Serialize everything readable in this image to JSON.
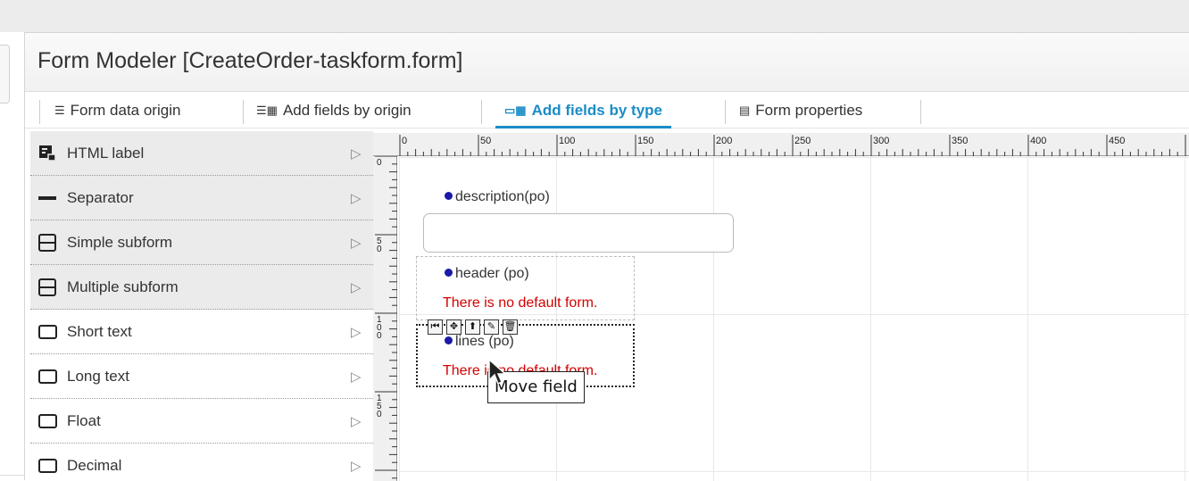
{
  "window": {
    "title": "Form Modeler [CreateOrder-taskform.form]"
  },
  "tabs": [
    {
      "label": "Form data origin",
      "icon": "database-icon",
      "active": false
    },
    {
      "label": "Add fields by origin",
      "icon": "add-fields-origin-icon",
      "active": false
    },
    {
      "label": "Add fields by type",
      "icon": "add-fields-type-icon",
      "active": true
    },
    {
      "label": "Form properties",
      "icon": "form-properties-icon",
      "active": false
    }
  ],
  "palette": {
    "items": [
      {
        "label": "HTML label",
        "icon": "html-label-icon"
      },
      {
        "label": "Separator",
        "icon": "separator-icon"
      },
      {
        "label": "Simple subform",
        "icon": "subform-icon"
      },
      {
        "label": "Multiple subform",
        "icon": "subform-icon"
      },
      {
        "label": "Short text",
        "icon": "textbox-icon"
      },
      {
        "label": "Long text",
        "icon": "textbox-icon"
      },
      {
        "label": "Float",
        "icon": "textbox-icon"
      },
      {
        "label": "Decimal",
        "icon": "textbox-icon"
      }
    ]
  },
  "ruler": {
    "top_labels": [
      "0",
      "50",
      "100",
      "150",
      "200",
      "250",
      "300",
      "350",
      "400",
      "450"
    ],
    "left_labels": [
      "0",
      "50",
      "100",
      "150"
    ]
  },
  "canvas": {
    "fields": [
      {
        "label": "description(po)"
      },
      {
        "label": "header (po)",
        "error": "There is no default form."
      },
      {
        "label": "lines (po)",
        "error": "There is no default form."
      }
    ],
    "field_toolbar": [
      "move-first-icon",
      "move-icon",
      "move-up-icon",
      "edit-icon",
      "delete-icon"
    ],
    "tooltip": "Move field"
  },
  "colors": {
    "accent": "#1a8cc7",
    "error": "#d40000",
    "bullet": "#1a1aa6"
  }
}
